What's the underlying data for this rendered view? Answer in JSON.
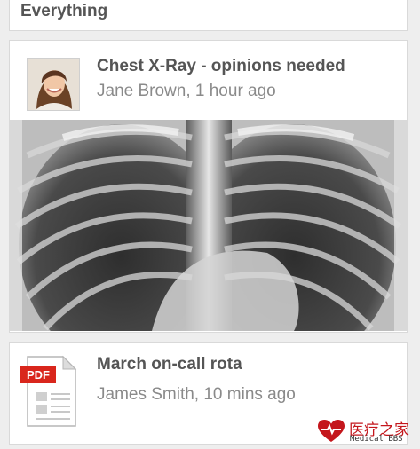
{
  "filter": {
    "label": "Everything"
  },
  "posts": [
    {
      "title": "Chest X-Ray - opinions needed",
      "author": "Jane Brown, 1 hour ago",
      "avatar_icon": "user-avatar",
      "attachment": "chest-xray-image"
    },
    {
      "title": "March on-call rota",
      "author": "James Smith, 10 mins ago",
      "file_icon": "pdf-document-icon",
      "file_badge": "PDF"
    }
  ],
  "watermark": {
    "cn": "医疗之家",
    "en": "Medical BBS"
  },
  "colors": {
    "background": "#eeeeee",
    "card": "#ffffff",
    "title": "#555555",
    "meta": "#8a8a8a",
    "pdf_red": "#d9261c",
    "brand_red": "#c4161c"
  }
}
